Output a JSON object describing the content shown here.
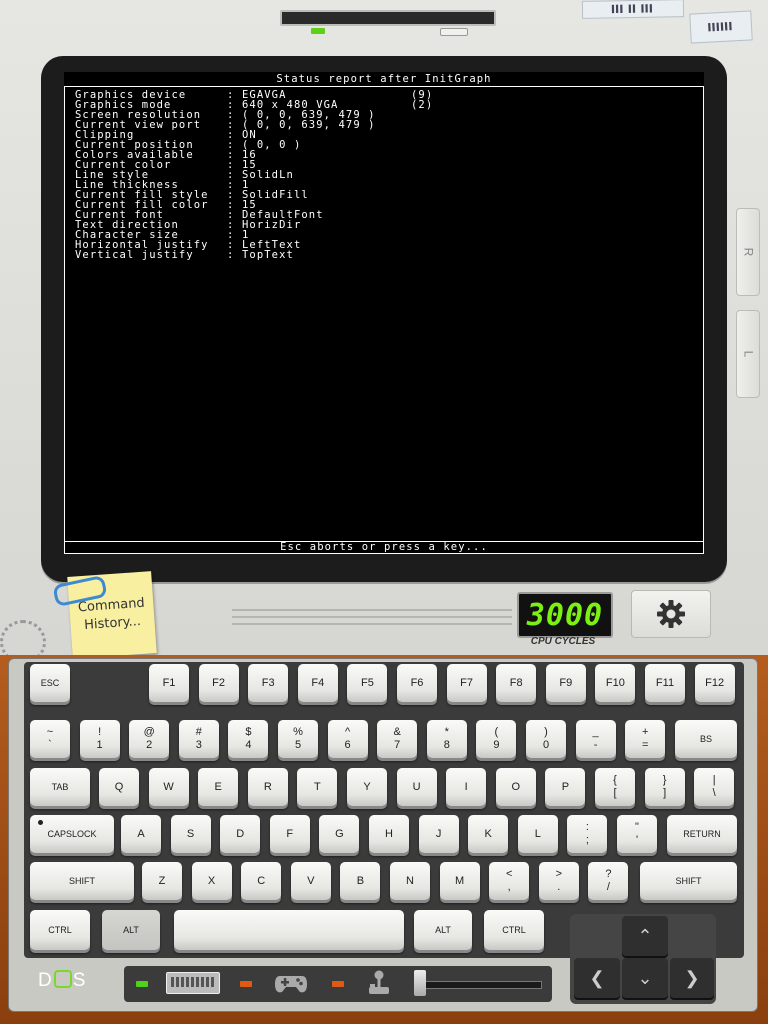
{
  "screen": {
    "title": "Status report after InitGraph",
    "footer": "Esc aborts or press a key...",
    "rows": [
      {
        "label": "Graphics device    ",
        "sep": ":",
        "value": "EGAVGA",
        "extra": "(9)"
      },
      {
        "label": "Graphics mode      ",
        "sep": ":",
        "value": "640 x 480 VGA",
        "extra": "(2)"
      },
      {
        "label": "Screen resolution  ",
        "sep": ":",
        "value": "( 0, 0, 639, 479 )",
        "extra": ""
      },
      {
        "label": "Current view port  ",
        "sep": ":",
        "value": "( 0, 0, 639, 479 )",
        "extra": ""
      },
      {
        "label": "Clipping           ",
        "sep": ":",
        "value": "ON",
        "extra": ""
      },
      {
        "label": "Current position   ",
        "sep": ":",
        "value": "( 0, 0 )",
        "extra": ""
      },
      {
        "label": "Colors available   ",
        "sep": ":",
        "value": "16",
        "extra": ""
      },
      {
        "label": "Current color      ",
        "sep": ":",
        "value": "15",
        "extra": ""
      },
      {
        "label": "Line style         ",
        "sep": ":",
        "value": "SolidLn",
        "extra": ""
      },
      {
        "label": "Line thickness     ",
        "sep": ":",
        "value": "1",
        "extra": ""
      },
      {
        "label": "Current fill style ",
        "sep": ":",
        "value": "SolidFill",
        "extra": ""
      },
      {
        "label": "Current fill color ",
        "sep": ":",
        "value": "15",
        "extra": ""
      },
      {
        "label": "Current font       ",
        "sep": ":",
        "value": "DefaultFont",
        "extra": ""
      },
      {
        "label": "Text direction     ",
        "sep": ":",
        "value": "HorizDir",
        "extra": ""
      },
      {
        "label": "Character size     ",
        "sep": ":",
        "value": "1",
        "extra": ""
      },
      {
        "label": "Horizontal justify ",
        "sep": ":",
        "value": "LeftText",
        "extra": ""
      },
      {
        "label": "Vertical justify   ",
        "sep": ":",
        "value": "TopText",
        "extra": ""
      }
    ]
  },
  "side_buttons": {
    "right": "R",
    "left": "L"
  },
  "command_history": {
    "label": "Command History..."
  },
  "cpu": {
    "value": "3000",
    "label": "CPU CYCLES",
    "color": "#7cf013"
  },
  "settings": {
    "icon": "gear-icon"
  },
  "keyboard": {
    "row_fn": [
      "ESC",
      "F1",
      "F2",
      "F3",
      "F4",
      "F5",
      "F6",
      "F7",
      "F8",
      "F9",
      "F10",
      "F11",
      "F12"
    ],
    "row_num": [
      [
        "~",
        "`"
      ],
      [
        "!",
        "1"
      ],
      [
        "@",
        "2"
      ],
      [
        "#",
        "3"
      ],
      [
        "$",
        "4"
      ],
      [
        "%",
        "5"
      ],
      [
        "^",
        "6"
      ],
      [
        "&",
        "7"
      ],
      [
        "*",
        "8"
      ],
      [
        "(",
        "9"
      ],
      [
        ")",
        "0"
      ],
      [
        "_",
        "-"
      ],
      [
        "+",
        "="
      ],
      [
        "BS",
        ""
      ]
    ],
    "row_q": [
      [
        "TAB",
        ""
      ],
      [
        "Q",
        ""
      ],
      [
        "W",
        ""
      ],
      [
        "E",
        ""
      ],
      [
        "R",
        ""
      ],
      [
        "T",
        ""
      ],
      [
        "Y",
        ""
      ],
      [
        "U",
        ""
      ],
      [
        "I",
        ""
      ],
      [
        "O",
        ""
      ],
      [
        "P",
        ""
      ],
      [
        "{",
        "["
      ],
      [
        "}",
        "]"
      ],
      [
        "|",
        "\\"
      ]
    ],
    "row_a": [
      [
        "CAPSLOCK",
        ""
      ],
      [
        "A",
        ""
      ],
      [
        "S",
        ""
      ],
      [
        "D",
        ""
      ],
      [
        "F",
        ""
      ],
      [
        "G",
        ""
      ],
      [
        "H",
        ""
      ],
      [
        "J",
        ""
      ],
      [
        "K",
        ""
      ],
      [
        "L",
        ""
      ],
      [
        ":",
        ";"
      ],
      [
        "\"",
        "'"
      ],
      [
        "RETURN",
        ""
      ]
    ],
    "row_z": [
      [
        "SHIFT",
        ""
      ],
      [
        "Z",
        ""
      ],
      [
        "X",
        ""
      ],
      [
        "C",
        ""
      ],
      [
        "V",
        ""
      ],
      [
        "B",
        ""
      ],
      [
        "N",
        ""
      ],
      [
        "M",
        ""
      ],
      [
        "<",
        ","
      ],
      [
        ">",
        "."
      ],
      [
        "?",
        "/"
      ],
      [
        "SHIFT",
        ""
      ]
    ],
    "row_mod": [
      "CTRL",
      "ALT",
      "",
      "ALT",
      "CTRL"
    ],
    "arrows": {
      "up": "⌃",
      "down": "⌄",
      "left": "❮",
      "right": "❯"
    }
  },
  "statusbar": {
    "logo": {
      "pre": "D",
      "post": "S"
    },
    "leds": {
      "power": "#4fd11a",
      "disk": "#e05a12",
      "joy": "#e05a12"
    },
    "icons": [
      "keyboard-icon",
      "gamepad-icon",
      "joystick-icon"
    ]
  }
}
